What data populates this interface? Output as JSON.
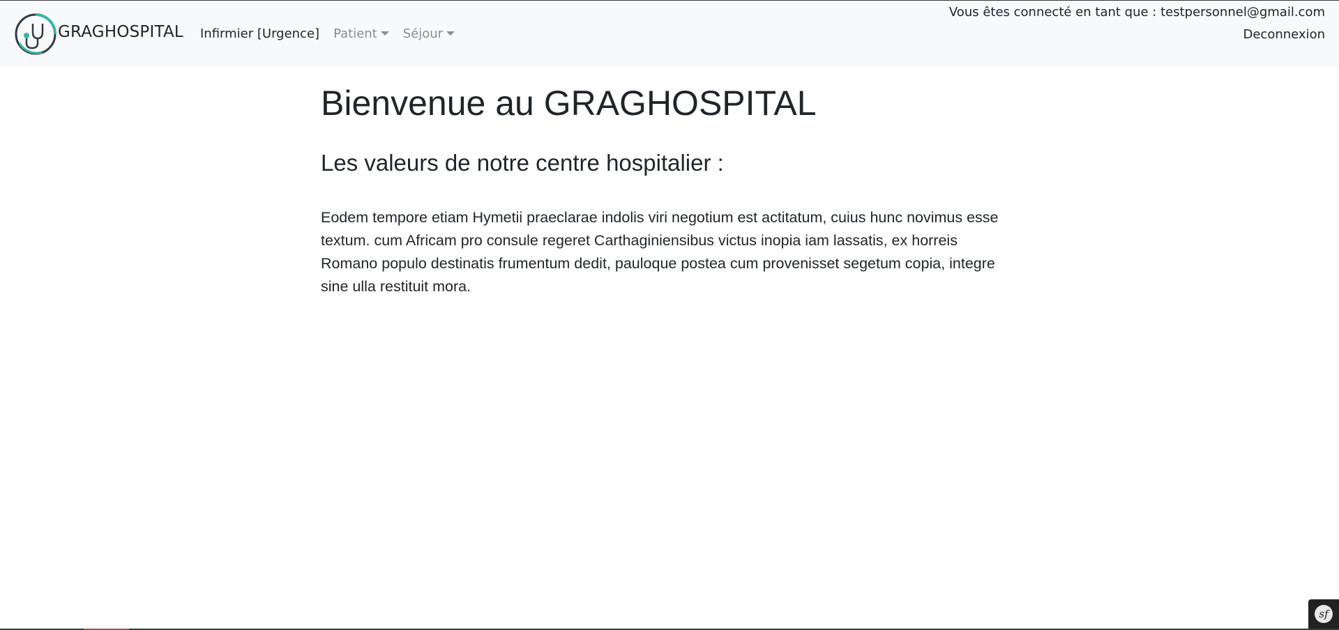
{
  "navbar": {
    "brand_name": "GRAGHOSPITAL",
    "items": [
      {
        "label": "Infirmier [Urgence]",
        "dropdown": false
      },
      {
        "label": "Patient",
        "dropdown": true
      },
      {
        "label": "Séjour",
        "dropdown": true
      }
    ],
    "user_info": "Vous êtes connecté en tant que : testpersonnel@gmail.com",
    "logout_label": "Deconnexion"
  },
  "main": {
    "title": "Bienvenue au GRAGHOSPITAL",
    "subtitle": "Les valeurs de notre centre hospitalier :",
    "paragraph": "Eodem tempore etiam Hymetii praeclarae indolis viri negotium est actitatum, cuius hunc novimus esse textum. cum Africam pro consule regeret Carthaginiensibus victus inopia iam lassatis, ex horreis Romano populo destinatis frumentum dedit, pauloque postea cum provenisset segetum copia, integre sine ulla restituit mora."
  },
  "debug_toolbar": {
    "icon": "symfony-icon",
    "glyph": "sf"
  },
  "colors": {
    "navbar_bg": "#f8f9fa",
    "logo_accent": "#3bb3a8",
    "logo_dark": "#2f3b45",
    "muted_text": "#888e94"
  }
}
